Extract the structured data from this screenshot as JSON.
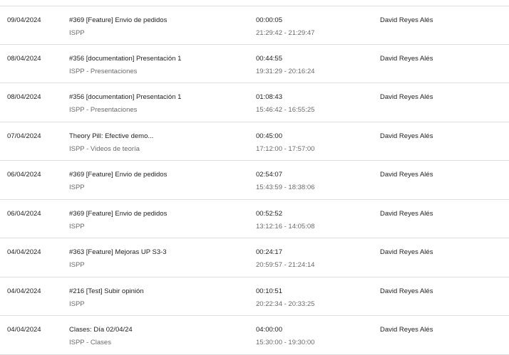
{
  "entries": [
    {
      "date": "09/04/2024",
      "task": "#369 [Feature] Envio de pedidos",
      "project": "ISPP",
      "duration": "00:00:05",
      "range": "21:29:42 - 21:29:47",
      "user": "David Reyes Alés"
    },
    {
      "date": "08/04/2024",
      "task": "#356 [documentation] Presentación 1",
      "project": "ISPP - Presentaciones",
      "duration": "00:44:55",
      "range": "19:31:29 - 20:16:24",
      "user": "David Reyes Alés"
    },
    {
      "date": "08/04/2024",
      "task": "#356 [documentation] Presentación 1",
      "project": "ISPP - Presentaciones",
      "duration": "01:08:43",
      "range": "15:46:42 - 16:55:25",
      "user": "David Reyes Alés"
    },
    {
      "date": "07/04/2024",
      "task": "Theory Pill: Efective demo...",
      "project": "ISPP - Videos de teoría",
      "duration": "00:45:00",
      "range": "17:12:00 - 17:57:00",
      "user": "David Reyes Alés"
    },
    {
      "date": "06/04/2024",
      "task": "#369 [Feature] Envio de pedidos",
      "project": "ISPP",
      "duration": "02:54:07",
      "range": "15:43:59 - 18:38:06",
      "user": "David Reyes Alés"
    },
    {
      "date": "06/04/2024",
      "task": "#369 [Feature] Envio de pedidos",
      "project": "ISPP",
      "duration": "00:52:52",
      "range": "13:12:16 - 14:05:08",
      "user": "David Reyes Alés"
    },
    {
      "date": "04/04/2024",
      "task": "#363 [Feature] Mejoras UP S3-3",
      "project": "ISPP",
      "duration": "00:24:17",
      "range": "20:59:57 - 21:24:14",
      "user": "David Reyes Alés"
    },
    {
      "date": "04/04/2024",
      "task": "#216 [Test] Subir opinión",
      "project": "ISPP",
      "duration": "00:10:51",
      "range": "20:22:34 - 20:33:25",
      "user": "David Reyes Alés"
    },
    {
      "date": "04/04/2024",
      "task": "Clases: Día 02/04/24",
      "project": "ISPP - Clases",
      "duration": "04:00:00",
      "range": "15:30:00 - 19:30:00",
      "user": "David Reyes Alés"
    }
  ]
}
